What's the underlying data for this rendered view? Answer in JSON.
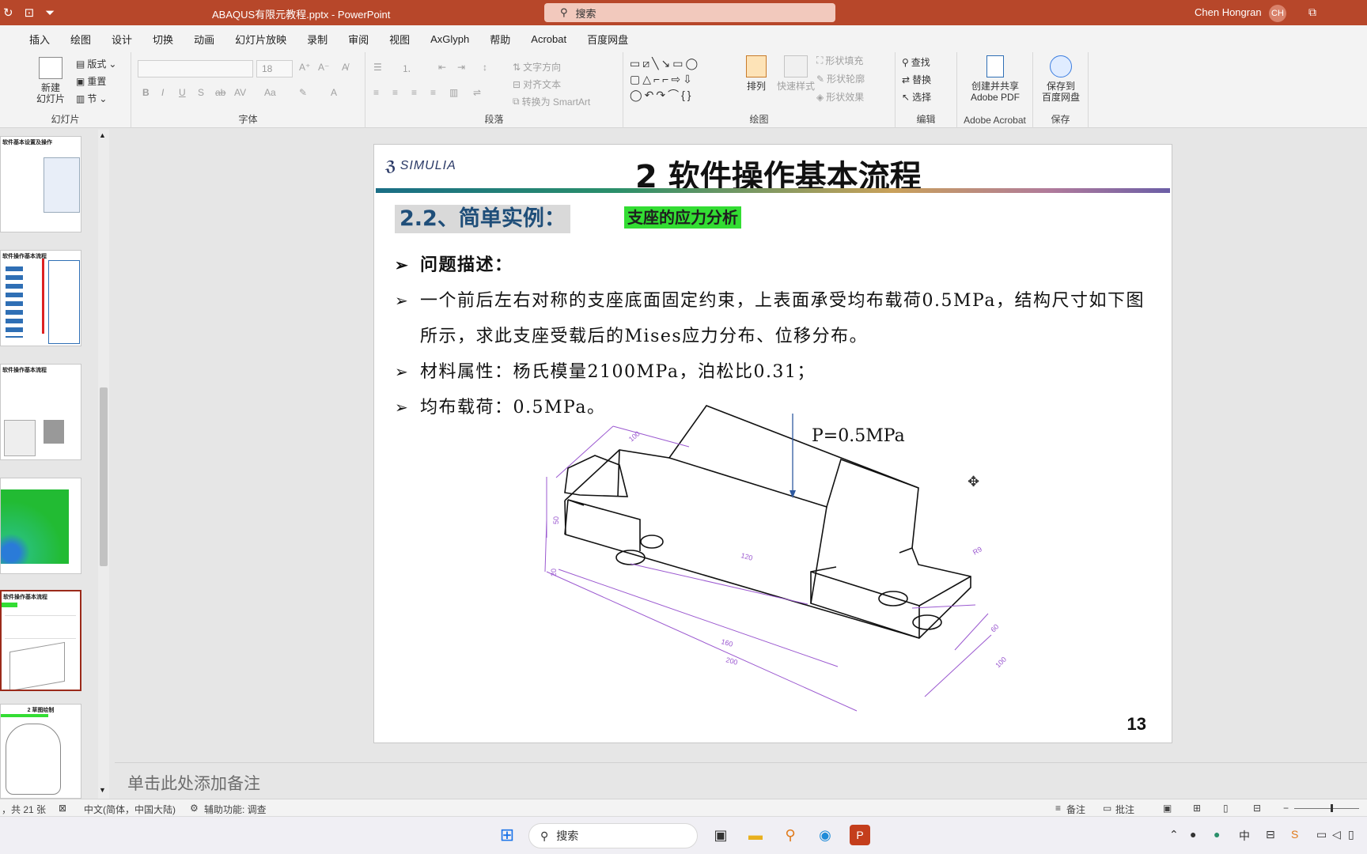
{
  "titlebar": {
    "doc_title": "ABAQUS有限元教程.pptx  -  PowerPoint",
    "search_placeholder": "搜索",
    "user_name": "Chen Hongran",
    "user_initials": "CH"
  },
  "menu": {
    "tabs": [
      "插入",
      "绘图",
      "设计",
      "切换",
      "动画",
      "幻灯片放映",
      "录制",
      "审阅",
      "视图",
      "AxGlyph",
      "帮助",
      "Acrobat",
      "百度网盘"
    ]
  },
  "ribbon": {
    "slides_group": {
      "label": "幻灯片",
      "new_slide": "新建\n幻灯片",
      "layout": "版式",
      "reset": "重置",
      "section": "节"
    },
    "font_group": {
      "label": "字体",
      "font_size": "18"
    },
    "paragraph_group": {
      "label": "段落",
      "text_direction": "文字方向",
      "align_text": "对齐文本",
      "convert_smartart": "转换为 SmartArt"
    },
    "drawing_group": {
      "label": "绘图",
      "arrange": "排列",
      "quick_styles": "快速样式",
      "shape_fill": "形状填充",
      "shape_outline": "形状轮廓",
      "shape_effects": "形状效果"
    },
    "editing_group": {
      "label": "编辑",
      "find": "查找",
      "replace": "替换",
      "select": "选择"
    },
    "acrobat_group": {
      "label": "Adobe Acrobat",
      "create_pdf": "创建并共享\nAdobe PDF"
    },
    "save_group": {
      "label": "保存",
      "save_baidu": "保存到\n百度网盘"
    }
  },
  "thumbnails": [
    {
      "title": "软件基本设置及操作"
    },
    {
      "title": "软件操作基本流程"
    },
    {
      "title": "软件操作基本流程"
    },
    {
      "title": ""
    },
    {
      "title": "软件操作基本流程"
    },
    {
      "title": "2 草图绘制"
    }
  ],
  "slide": {
    "logo_text": "SIMULIA",
    "title": "2 软件操作基本流程",
    "section_heading": "2.2、简单实例：",
    "section_tag": "支座的应力分析",
    "bullets": [
      "问题描述：",
      "一个前后左右对称的支座底面固定约束，上表面承受均布载荷0.5MPa，结构尺寸如下图所示，求此支座受载后的Mises应力分布、位移分布。",
      "材料属性：杨氏模量2100MPa，泊松比0.31；",
      "均布载荷：0.5MPa。"
    ],
    "load_label": "P=0.5MPa",
    "dimensions": {
      "d100_top": "100",
      "d50": "50",
      "d20": "20",
      "d120": "120",
      "d160": "160",
      "d200": "200",
      "r9": "R9",
      "d60": "60",
      "d100_right": "100"
    },
    "page_number": "13"
  },
  "notes": {
    "placeholder": "单击此处添加备注"
  },
  "statusbar": {
    "slide_count": "，共 21 张",
    "language": "中文(简体，中国大陆)",
    "accessibility": "辅助功能: 调查",
    "notes_btn": "备注",
    "comments_btn": "批注"
  },
  "taskbar": {
    "search_placeholder": "搜索"
  },
  "colors": {
    "accent": "#b7472a",
    "dimension_line": "#9b59d0",
    "section_heading": "#1f4e79",
    "section_tag_bg": "#33dd33"
  }
}
